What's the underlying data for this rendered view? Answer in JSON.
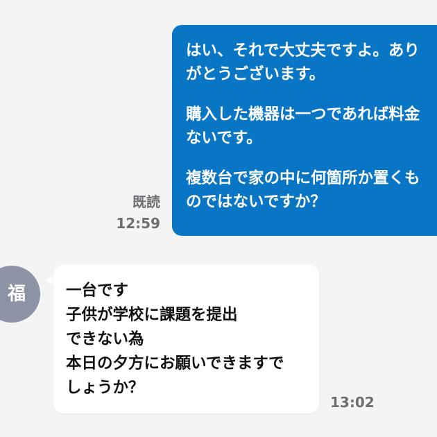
{
  "conversation": {
    "outgoing": {
      "paragraphs": [
        "はい、それで大丈夫ですよ。ありがとうございます。",
        "購入した機器は一つであれば料金ないです。",
        "複数台で家の中に何箇所か置くものではないですか？"
      ],
      "status": "既読",
      "time": "12:59"
    },
    "incoming": {
      "avatar_initial": "福",
      "message": "一台です\n子供が学校に課題を提出\nできない為\n本日の夕方にお願いできますで\nしょうか？",
      "time": "13:02"
    }
  },
  "colors": {
    "background": "#f4f4f5",
    "outgoing_bubble": "#0875c5",
    "incoming_bubble": "#ffffff",
    "avatar": "#8c93a4",
    "meta_text": "#6e6e73"
  }
}
